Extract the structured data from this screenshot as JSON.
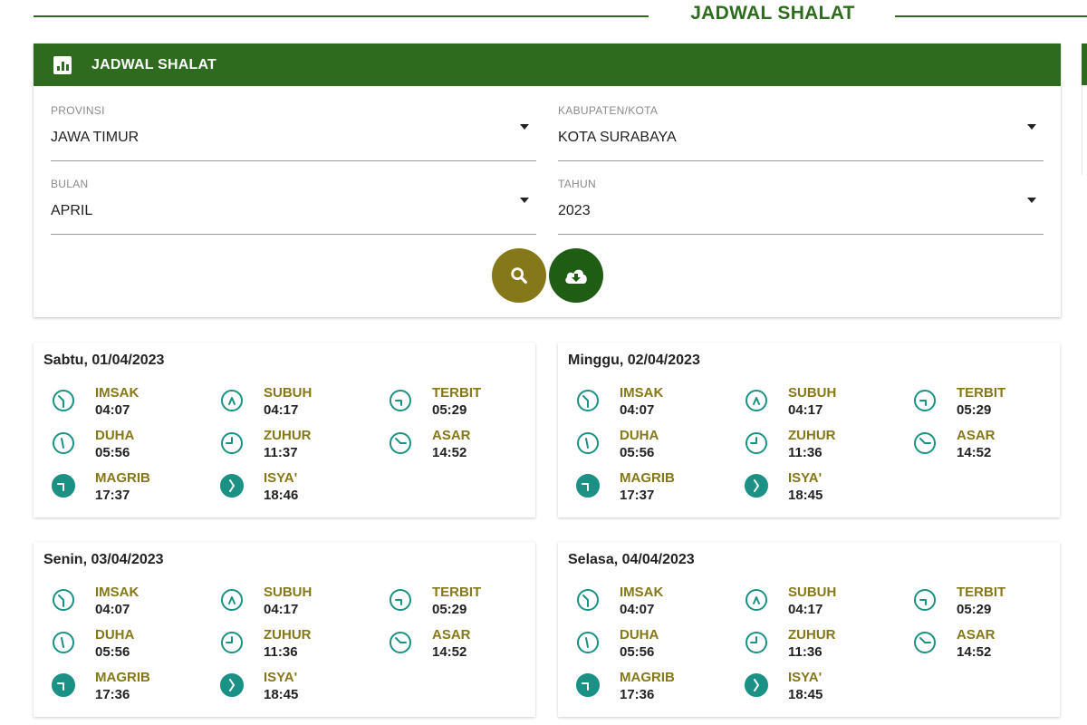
{
  "page_title": "JADWAL SHALAT",
  "panel": {
    "title": "JADWAL SHALAT",
    "fields": {
      "provinsi": {
        "label": "PROVINSI",
        "value": "JAWA TIMUR"
      },
      "kabupaten": {
        "label": "KABUPATEN/KOTA",
        "value": "KOTA SURABAYA"
      },
      "bulan": {
        "label": "BULAN",
        "value": "APRIL"
      },
      "tahun": {
        "label": "TAHUN",
        "value": "2023"
      }
    },
    "buttons": {
      "search_icon": "search-icon",
      "download_icon": "cloud-download-icon"
    }
  },
  "colors": {
    "primary": "#2e6b1f",
    "accent_gold": "#857818",
    "icon_teal": "#1a9184"
  },
  "days": [
    {
      "date": "Sabtu, 01/04/2023",
      "times": [
        {
          "name": "IMSAK",
          "time": "04:07"
        },
        {
          "name": "SUBUH",
          "time": "04:17"
        },
        {
          "name": "TERBIT",
          "time": "05:29"
        },
        {
          "name": "DUHA",
          "time": "05:56"
        },
        {
          "name": "ZUHUR",
          "time": "11:37"
        },
        {
          "name": "ASAR",
          "time": "14:52"
        },
        {
          "name": "MAGRIB",
          "time": "17:37"
        },
        {
          "name": "ISYA'",
          "time": "18:46"
        }
      ]
    },
    {
      "date": "Minggu, 02/04/2023",
      "times": [
        {
          "name": "IMSAK",
          "time": "04:07"
        },
        {
          "name": "SUBUH",
          "time": "04:17"
        },
        {
          "name": "TERBIT",
          "time": "05:29"
        },
        {
          "name": "DUHA",
          "time": "05:56"
        },
        {
          "name": "ZUHUR",
          "time": "11:36"
        },
        {
          "name": "ASAR",
          "time": "14:52"
        },
        {
          "name": "MAGRIB",
          "time": "17:37"
        },
        {
          "name": "ISYA'",
          "time": "18:45"
        }
      ]
    },
    {
      "date": "Senin, 03/04/2023",
      "times": [
        {
          "name": "IMSAK",
          "time": "04:07"
        },
        {
          "name": "SUBUH",
          "time": "04:17"
        },
        {
          "name": "TERBIT",
          "time": "05:29"
        },
        {
          "name": "DUHA",
          "time": "05:56"
        },
        {
          "name": "ZUHUR",
          "time": "11:36"
        },
        {
          "name": "ASAR",
          "time": "14:52"
        },
        {
          "name": "MAGRIB",
          "time": "17:36"
        },
        {
          "name": "ISYA'",
          "time": "18:45"
        }
      ]
    },
    {
      "date": "Selasa, 04/04/2023",
      "times": [
        {
          "name": "IMSAK",
          "time": "04:07"
        },
        {
          "name": "SUBUH",
          "time": "04:17"
        },
        {
          "name": "TERBIT",
          "time": "05:29"
        },
        {
          "name": "DUHA",
          "time": "05:56"
        },
        {
          "name": "ZUHUR",
          "time": "11:36"
        },
        {
          "name": "ASAR",
          "time": "14:52"
        },
        {
          "name": "MAGRIB",
          "time": "17:36"
        },
        {
          "name": "ISYA'",
          "time": "18:45"
        }
      ]
    }
  ]
}
